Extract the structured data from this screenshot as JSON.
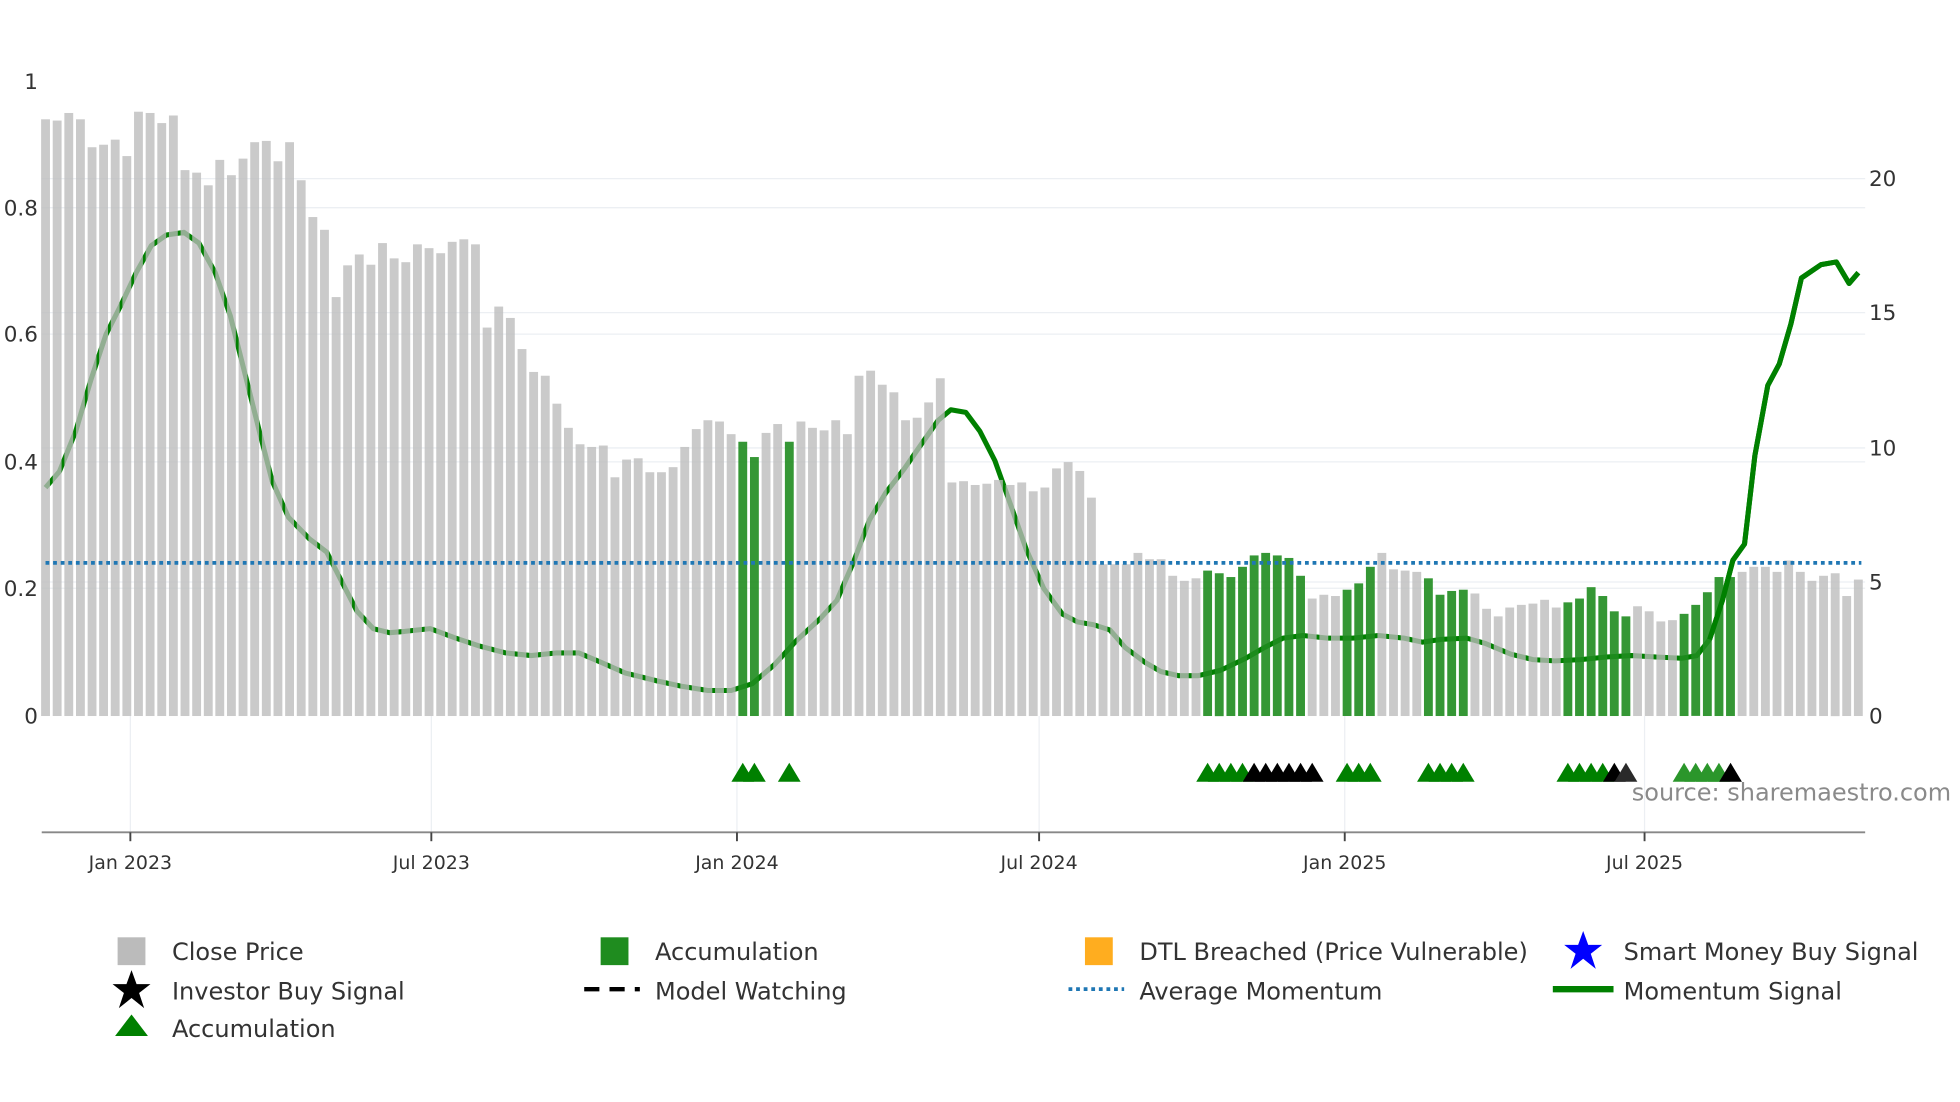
{
  "chart_data": {
    "type": "bar",
    "title": "",
    "x_unit": "week index",
    "y_left": {
      "ylim": [
        0,
        1
      ],
      "ticks": [
        "0",
        "0.2",
        "0.4",
        "0.6",
        "0.8",
        "1"
      ]
    },
    "y_right": {
      "ylim": [
        0,
        23.6
      ],
      "ticks": [
        "0",
        "5",
        "10",
        "15",
        "20"
      ]
    },
    "x_ticks": [
      {
        "label": "Jan 2023",
        "at": 7.3
      },
      {
        "label": "Jul 2023",
        "at": 33.2
      },
      {
        "label": "Jan 2024",
        "at": 59.5
      },
      {
        "label": "Jul 2024",
        "at": 85.5
      },
      {
        "label": "Jan 2025",
        "at": 111.8
      },
      {
        "label": "Jul 2025",
        "at": 137.6
      }
    ],
    "close_price": [
      0.94,
      0.938,
      0.95,
      0.94,
      0.896,
      0.9,
      0.908,
      0.882,
      0.952,
      0.95,
      0.934,
      0.946,
      0.86,
      0.856,
      0.836,
      0.876,
      0.852,
      0.878,
      0.904,
      0.906,
      0.874,
      0.904,
      0.844,
      0.786,
      0.766,
      0.66,
      0.71,
      0.727,
      0.711,
      0.745,
      0.721,
      0.715,
      0.743,
      0.737,
      0.729,
      0.747,
      0.751,
      0.743,
      0.612,
      0.645,
      0.627,
      0.578,
      0.542,
      0.536,
      0.492,
      0.454,
      0.428,
      0.424,
      0.426,
      0.376,
      0.404,
      0.406,
      0.384,
      0.384,
      0.392,
      0.424,
      0.452,
      0.466,
      0.464,
      0.444,
      0.432,
      0.408,
      0.446,
      0.46,
      0.432,
      0.464,
      0.454,
      0.45,
      0.466,
      0.444,
      0.536,
      0.544,
      0.522,
      0.51,
      0.466,
      0.47,
      0.494,
      0.532,
      0.368,
      0.37,
      0.364,
      0.366,
      0.372,
      0.364,
      0.368,
      0.354,
      0.36,
      0.39,
      0.4,
      0.386,
      0.344,
      0.239,
      0.239,
      0.239,
      0.257,
      0.247,
      0.247,
      0.221,
      0.213,
      0.217,
      0.229,
      0.225,
      0.219,
      0.235,
      0.253,
      0.257,
      0.253,
      0.249,
      0.221,
      0.185,
      0.191,
      0.189,
      0.199,
      0.209,
      0.235,
      0.257,
      0.231,
      0.229,
      0.227,
      0.217,
      0.191,
      0.197,
      0.199,
      0.193,
      0.169,
      0.157,
      0.171,
      0.175,
      0.177,
      0.183,
      0.171,
      0.179,
      0.185,
      0.203,
      0.189,
      0.165,
      0.157,
      0.173,
      0.165,
      0.149,
      0.151,
      0.161,
      0.175,
      0.195,
      0.219,
      0.219,
      0.227,
      0.235,
      0.235,
      0.227,
      0.245,
      0.227,
      0.213,
      0.221,
      0.225,
      0.189,
      0.215
    ],
    "accumulation_bars": [
      60,
      61,
      64,
      100,
      101,
      102,
      103,
      104,
      105,
      106,
      107,
      108,
      112,
      113,
      114,
      119,
      120,
      121,
      122,
      131,
      132,
      133,
      134,
      135,
      136,
      141,
      142,
      143,
      144,
      145
    ],
    "momentum_signal": {
      "x": [
        0,
        1.2,
        2.6,
        3.9,
        5.2,
        6.5,
        7.8,
        9.1,
        10.4,
        11.9,
        13.2,
        14.6,
        15.9,
        17.3,
        18.4,
        19.5,
        20.9,
        22.7,
        24.2,
        25.5,
        26.8,
        28.2,
        29.6,
        30.9,
        33.1,
        35.3,
        37.4,
        39.6,
        41.8,
        44.0,
        45.9,
        47.8,
        49.9,
        52.7,
        54.8,
        57.0,
        59.0,
        60.8,
        62.7,
        64.6,
        66.6,
        68.1,
        69.5,
        70.9,
        72.3,
        73.9,
        75.5,
        76.8,
        77.9,
        79.2,
        80.4,
        81.7,
        83.1,
        84.4,
        85.9,
        87.5,
        88.8,
        90.2,
        91.6,
        92.9,
        94.6,
        96.0,
        97.5,
        99.2,
        101.1,
        103.3,
        104.9,
        106.5,
        108.2,
        110.3,
        112.5,
        114.7,
        116.9,
        118.5,
        120.1,
        122.3,
        123.9,
        126.1,
        128.0,
        129.9,
        132.1,
        134.3,
        136.5,
        138.6,
        140.8,
        142.1,
        143.2,
        144.3,
        145.2,
        146.2,
        147.1,
        148.2,
        149.2,
        150.2,
        151.1,
        152.8,
        154.1,
        155.2,
        156.0
      ],
      "y": [
        8.5,
        9.1,
        10.6,
        12.5,
        14.2,
        15.3,
        16.5,
        17.5,
        17.9,
        18.0,
        17.6,
        16.5,
        14.9,
        12.5,
        10.6,
        8.75,
        7.4,
        6.6,
        6.1,
        5.0,
        3.9,
        3.25,
        3.1,
        3.15,
        3.25,
        2.9,
        2.6,
        2.35,
        2.25,
        2.35,
        2.35,
        2.0,
        1.6,
        1.3,
        1.1,
        0.95,
        0.95,
        1.2,
        1.9,
        2.8,
        3.6,
        4.3,
        5.7,
        7.3,
        8.3,
        9.2,
        10.2,
        11.0,
        11.4,
        11.3,
        10.6,
        9.5,
        7.8,
        6.2,
        4.75,
        3.8,
        3.5,
        3.4,
        3.2,
        2.55,
        2.0,
        1.65,
        1.5,
        1.5,
        1.7,
        2.15,
        2.55,
        2.9,
        3.0,
        2.9,
        2.9,
        3.0,
        2.9,
        2.75,
        2.85,
        2.9,
        2.7,
        2.3,
        2.1,
        2.05,
        2.1,
        2.2,
        2.25,
        2.2,
        2.15,
        2.25,
        2.85,
        4.3,
        5.8,
        6.4,
        9.7,
        12.3,
        13.1,
        14.6,
        16.3,
        16.8,
        16.9,
        16.1,
        16.5
      ]
    },
    "average_momentum": 5.7,
    "markers": {
      "accumulation": [
        60,
        61,
        64,
        100,
        101,
        102,
        103,
        112,
        113,
        114,
        119,
        120,
        121,
        122,
        131,
        132,
        133,
        134,
        141,
        142,
        143,
        144
      ],
      "investor_buy": [
        104,
        105,
        106,
        107,
        108,
        109,
        135,
        145
      ],
      "dimmed": [
        136
      ]
    },
    "legend": [
      {
        "label": "Close Price",
        "color": "#bbbbbb",
        "symbol": "square"
      },
      {
        "label": "Accumulation",
        "color": "#1f8c1f",
        "symbol": "square"
      },
      {
        "label": "DTL Breached (Price Vulnerable)",
        "color": "#ffad1f",
        "symbol": "square"
      },
      {
        "label": "Smart Money Buy Signal",
        "color": "#0000ff",
        "symbol": "star"
      },
      {
        "label": "Investor Buy Signal",
        "color": "#000000",
        "symbol": "star"
      },
      {
        "label": "Model Watching",
        "color": "#000000",
        "symbol": "dash"
      },
      {
        "label": "Average Momentum",
        "color": "#1f77b4",
        "symbol": "dot"
      },
      {
        "label": "Momentum Signal",
        "color": "#008000",
        "symbol": "line"
      },
      {
        "label": "Accumulation",
        "color": "#008000",
        "symbol": "triangle"
      }
    ],
    "legend_placement": "bottom",
    "grid": true
  },
  "source": "source: sharemaestro.com",
  "colors": {
    "price": "#bbbbbb",
    "accum": "#1f8c1f",
    "momentum": "#008000",
    "avg": "#1f77b4"
  }
}
